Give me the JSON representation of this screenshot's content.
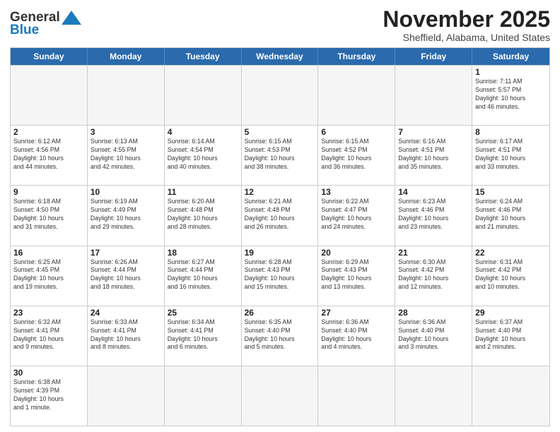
{
  "header": {
    "logo_general": "General",
    "logo_blue": "Blue",
    "month": "November 2025",
    "location": "Sheffield, Alabama, United States"
  },
  "days_of_week": [
    "Sunday",
    "Monday",
    "Tuesday",
    "Wednesday",
    "Thursday",
    "Friday",
    "Saturday"
  ],
  "rows": [
    [
      {
        "day": "",
        "info": ""
      },
      {
        "day": "",
        "info": ""
      },
      {
        "day": "",
        "info": ""
      },
      {
        "day": "",
        "info": ""
      },
      {
        "day": "",
        "info": ""
      },
      {
        "day": "",
        "info": ""
      },
      {
        "day": "1",
        "info": "Sunrise: 7:11 AM\nSunset: 5:57 PM\nDaylight: 10 hours\nand 46 minutes."
      }
    ],
    [
      {
        "day": "2",
        "info": "Sunrise: 6:12 AM\nSunset: 4:56 PM\nDaylight: 10 hours\nand 44 minutes."
      },
      {
        "day": "3",
        "info": "Sunrise: 6:13 AM\nSunset: 4:55 PM\nDaylight: 10 hours\nand 42 minutes."
      },
      {
        "day": "4",
        "info": "Sunrise: 6:14 AM\nSunset: 4:54 PM\nDaylight: 10 hours\nand 40 minutes."
      },
      {
        "day": "5",
        "info": "Sunrise: 6:15 AM\nSunset: 4:53 PM\nDaylight: 10 hours\nand 38 minutes."
      },
      {
        "day": "6",
        "info": "Sunrise: 6:15 AM\nSunset: 4:52 PM\nDaylight: 10 hours\nand 36 minutes."
      },
      {
        "day": "7",
        "info": "Sunrise: 6:16 AM\nSunset: 4:51 PM\nDaylight: 10 hours\nand 35 minutes."
      },
      {
        "day": "8",
        "info": "Sunrise: 6:17 AM\nSunset: 4:51 PM\nDaylight: 10 hours\nand 33 minutes."
      }
    ],
    [
      {
        "day": "9",
        "info": "Sunrise: 6:18 AM\nSunset: 4:50 PM\nDaylight: 10 hours\nand 31 minutes."
      },
      {
        "day": "10",
        "info": "Sunrise: 6:19 AM\nSunset: 4:49 PM\nDaylight: 10 hours\nand 29 minutes."
      },
      {
        "day": "11",
        "info": "Sunrise: 6:20 AM\nSunset: 4:48 PM\nDaylight: 10 hours\nand 28 minutes."
      },
      {
        "day": "12",
        "info": "Sunrise: 6:21 AM\nSunset: 4:48 PM\nDaylight: 10 hours\nand 26 minutes."
      },
      {
        "day": "13",
        "info": "Sunrise: 6:22 AM\nSunset: 4:47 PM\nDaylight: 10 hours\nand 24 minutes."
      },
      {
        "day": "14",
        "info": "Sunrise: 6:23 AM\nSunset: 4:46 PM\nDaylight: 10 hours\nand 23 minutes."
      },
      {
        "day": "15",
        "info": "Sunrise: 6:24 AM\nSunset: 4:46 PM\nDaylight: 10 hours\nand 21 minutes."
      }
    ],
    [
      {
        "day": "16",
        "info": "Sunrise: 6:25 AM\nSunset: 4:45 PM\nDaylight: 10 hours\nand 19 minutes."
      },
      {
        "day": "17",
        "info": "Sunrise: 6:26 AM\nSunset: 4:44 PM\nDaylight: 10 hours\nand 18 minutes."
      },
      {
        "day": "18",
        "info": "Sunrise: 6:27 AM\nSunset: 4:44 PM\nDaylight: 10 hours\nand 16 minutes."
      },
      {
        "day": "19",
        "info": "Sunrise: 6:28 AM\nSunset: 4:43 PM\nDaylight: 10 hours\nand 15 minutes."
      },
      {
        "day": "20",
        "info": "Sunrise: 6:29 AM\nSunset: 4:43 PM\nDaylight: 10 hours\nand 13 minutes."
      },
      {
        "day": "21",
        "info": "Sunrise: 6:30 AM\nSunset: 4:42 PM\nDaylight: 10 hours\nand 12 minutes."
      },
      {
        "day": "22",
        "info": "Sunrise: 6:31 AM\nSunset: 4:42 PM\nDaylight: 10 hours\nand 10 minutes."
      }
    ],
    [
      {
        "day": "23",
        "info": "Sunrise: 6:32 AM\nSunset: 4:41 PM\nDaylight: 10 hours\nand 9 minutes."
      },
      {
        "day": "24",
        "info": "Sunrise: 6:33 AM\nSunset: 4:41 PM\nDaylight: 10 hours\nand 8 minutes."
      },
      {
        "day": "25",
        "info": "Sunrise: 6:34 AM\nSunset: 4:41 PM\nDaylight: 10 hours\nand 6 minutes."
      },
      {
        "day": "26",
        "info": "Sunrise: 6:35 AM\nSunset: 4:40 PM\nDaylight: 10 hours\nand 5 minutes."
      },
      {
        "day": "27",
        "info": "Sunrise: 6:36 AM\nSunset: 4:40 PM\nDaylight: 10 hours\nand 4 minutes."
      },
      {
        "day": "28",
        "info": "Sunrise: 6:36 AM\nSunset: 4:40 PM\nDaylight: 10 hours\nand 3 minutes."
      },
      {
        "day": "29",
        "info": "Sunrise: 6:37 AM\nSunset: 4:40 PM\nDaylight: 10 hours\nand 2 minutes."
      }
    ],
    [
      {
        "day": "30",
        "info": "Sunrise: 6:38 AM\nSunset: 4:39 PM\nDaylight: 10 hours\nand 1 minute."
      },
      {
        "day": "",
        "info": ""
      },
      {
        "day": "",
        "info": ""
      },
      {
        "day": "",
        "info": ""
      },
      {
        "day": "",
        "info": ""
      },
      {
        "day": "",
        "info": ""
      },
      {
        "day": "",
        "info": ""
      }
    ]
  ]
}
